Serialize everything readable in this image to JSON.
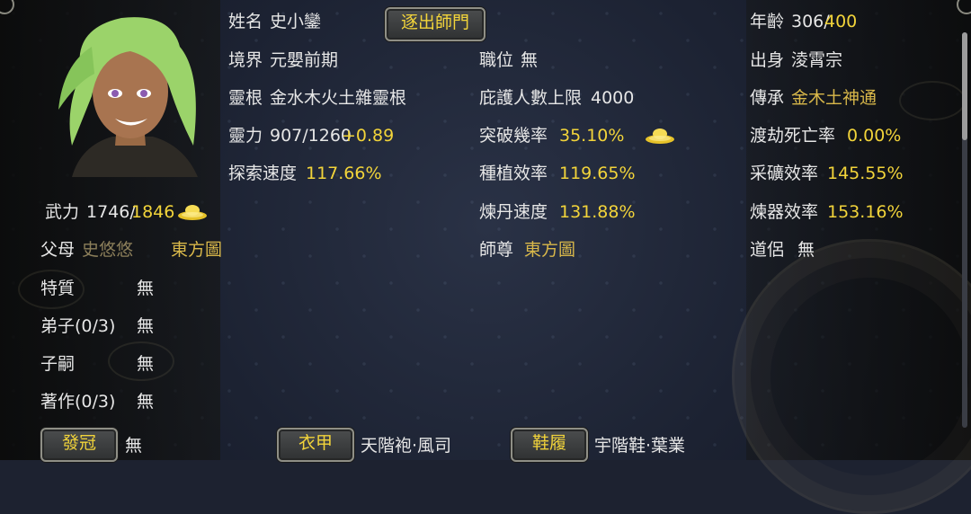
{
  "character": {
    "name_label": "姓名",
    "name": "史小鑾",
    "realm_label": "境界",
    "realm": "元嬰前期",
    "root_label": "靈根",
    "root": "金水木火土雜靈根",
    "spirit_label": "靈力",
    "spirit_value": "907/1260",
    "spirit_bonus": "+0.89",
    "explore_label": "探索速度",
    "explore_value": "117.66%"
  },
  "combat": {
    "label": "武力",
    "current": "1746/",
    "max": "1846"
  },
  "family": {
    "parents_label": "父母",
    "parent1": "史悠悠",
    "parent2": "東方圖",
    "traits_label": "特質",
    "traits_value": "無",
    "disciples_label": "弟子(0/3)",
    "disciples_value": "無",
    "heir_label": "子嗣",
    "heir_value": "無",
    "works_label": "著作(0/3)",
    "works_value": "無"
  },
  "middle": {
    "expel_button": "逐出師門",
    "post_label": "職位",
    "post_value": "無",
    "protect_label": "庇護人數上限",
    "protect_value": "4000",
    "breakthrough_label": "突破幾率",
    "breakthrough_value": "35.10%",
    "planting_label": "種植效率",
    "planting_value": "119.65%",
    "alchemy_label": "煉丹速度",
    "alchemy_value": "131.88%",
    "master_label": "師尊",
    "master_value": "東方圖"
  },
  "right": {
    "age_label": "年齡",
    "age_current": "306/",
    "age_max": "400",
    "origin_label": "出身",
    "origin_value": "淩霄宗",
    "inherit_label": "傳承",
    "inherit_value": "金木土神通",
    "tribulation_label": "渡劫死亡率",
    "tribulation_value": "0.00%",
    "mining_label": "采礦效率",
    "mining_value": "145.55%",
    "forging_label": "煉器效率",
    "forging_value": "153.16%",
    "partner_label": "道侶",
    "partner_value": "無"
  },
  "equipment": {
    "hat_button": "發冠",
    "hat_value": "無",
    "armor_button": "衣甲",
    "armor_value": "天階袍·風司",
    "shoes_button": "鞋履",
    "shoes_value": "宇階鞋·葉業"
  },
  "colors": {
    "highlight": "#f2d43a",
    "gold": "#d9b84a",
    "muted": "#8c7f5a",
    "text": "#e6e6e6"
  },
  "icons": [
    "gold-ingot-icon",
    "character-portrait"
  ]
}
